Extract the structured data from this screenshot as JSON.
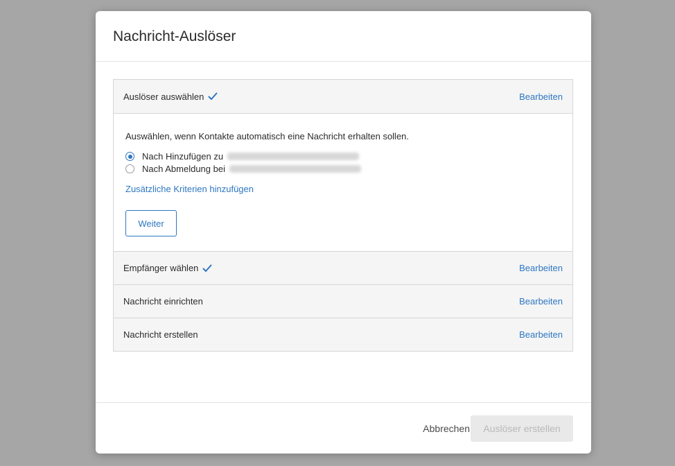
{
  "dialog": {
    "title": "Nachricht-Auslöser"
  },
  "steps": [
    {
      "title": "Auslöser auswählen",
      "completed": true,
      "edit_label": "Bearbeiten",
      "expanded": true
    },
    {
      "title": "Empfänger wählen",
      "completed": true,
      "edit_label": "Bearbeiten"
    },
    {
      "title": "Nachricht einrichten",
      "completed": false,
      "edit_label": "Bearbeiten"
    },
    {
      "title": "Nachricht erstellen",
      "completed": false,
      "edit_label": "Bearbeiten"
    }
  ],
  "trigger_step": {
    "intro": "Auswählen, wenn Kontakte automatisch eine Nachricht erhalten sollen.",
    "options": [
      {
        "label": "Nach Hinzufügen zu",
        "selected": true
      },
      {
        "label": "Nach Abmeldung bei",
        "selected": false
      }
    ],
    "add_criteria_link": "Zusätzliche Kriterien hinzufügen",
    "next_button": "Weiter"
  },
  "footer": {
    "cancel_label": "Abbrechen",
    "create_label": "Auslöser erstellen",
    "create_enabled": false
  },
  "colors": {
    "accent": "#2d77c2",
    "backdrop": "#a6a6a6",
    "header_bg": "#f5f5f5",
    "disabled_bg": "#e9e9e9"
  },
  "icons": {
    "completed": "check-icon"
  }
}
